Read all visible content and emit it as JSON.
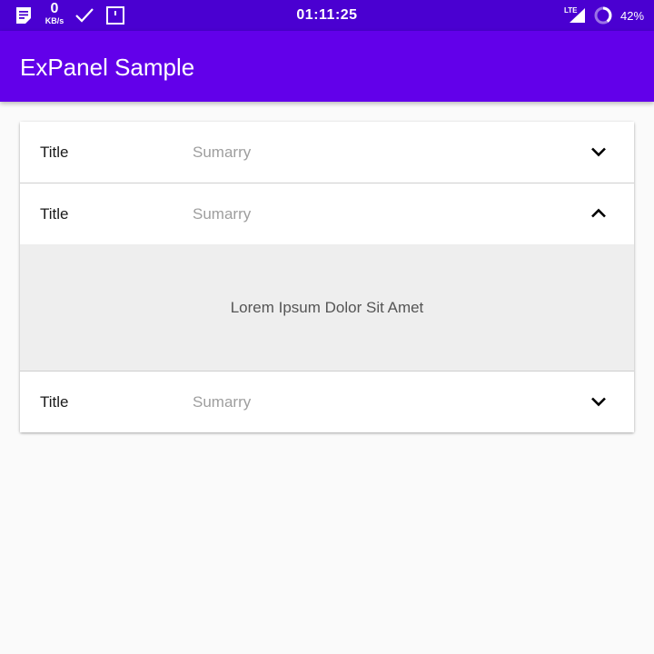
{
  "colors": {
    "status_bar": "#4a00d1",
    "app_bar": "#6200ea",
    "background": "#fafafa",
    "panel_content_bg": "#eeeeee",
    "summary_text": "#9e9e9e"
  },
  "status_bar": {
    "speed_value": "0",
    "speed_unit": "KB/s",
    "time": "01:11:25",
    "network": "LTE",
    "battery_percent": "42%",
    "icons": [
      "notes-icon",
      "check-icon",
      "alert-icon",
      "signal-icon",
      "battery-icon"
    ]
  },
  "app_bar": {
    "title": "ExPanel Sample"
  },
  "panels": [
    {
      "title": "Title",
      "summary": "Sumarry",
      "expanded": false,
      "chevron_icon": "chevron-down-icon"
    },
    {
      "title": "Title",
      "summary": "Sumarry",
      "expanded": true,
      "chevron_icon": "chevron-up-icon",
      "content": "Lorem Ipsum Dolor Sit Amet"
    },
    {
      "title": "Title",
      "summary": "Sumarry",
      "expanded": false,
      "chevron_icon": "chevron-down-icon"
    }
  ]
}
